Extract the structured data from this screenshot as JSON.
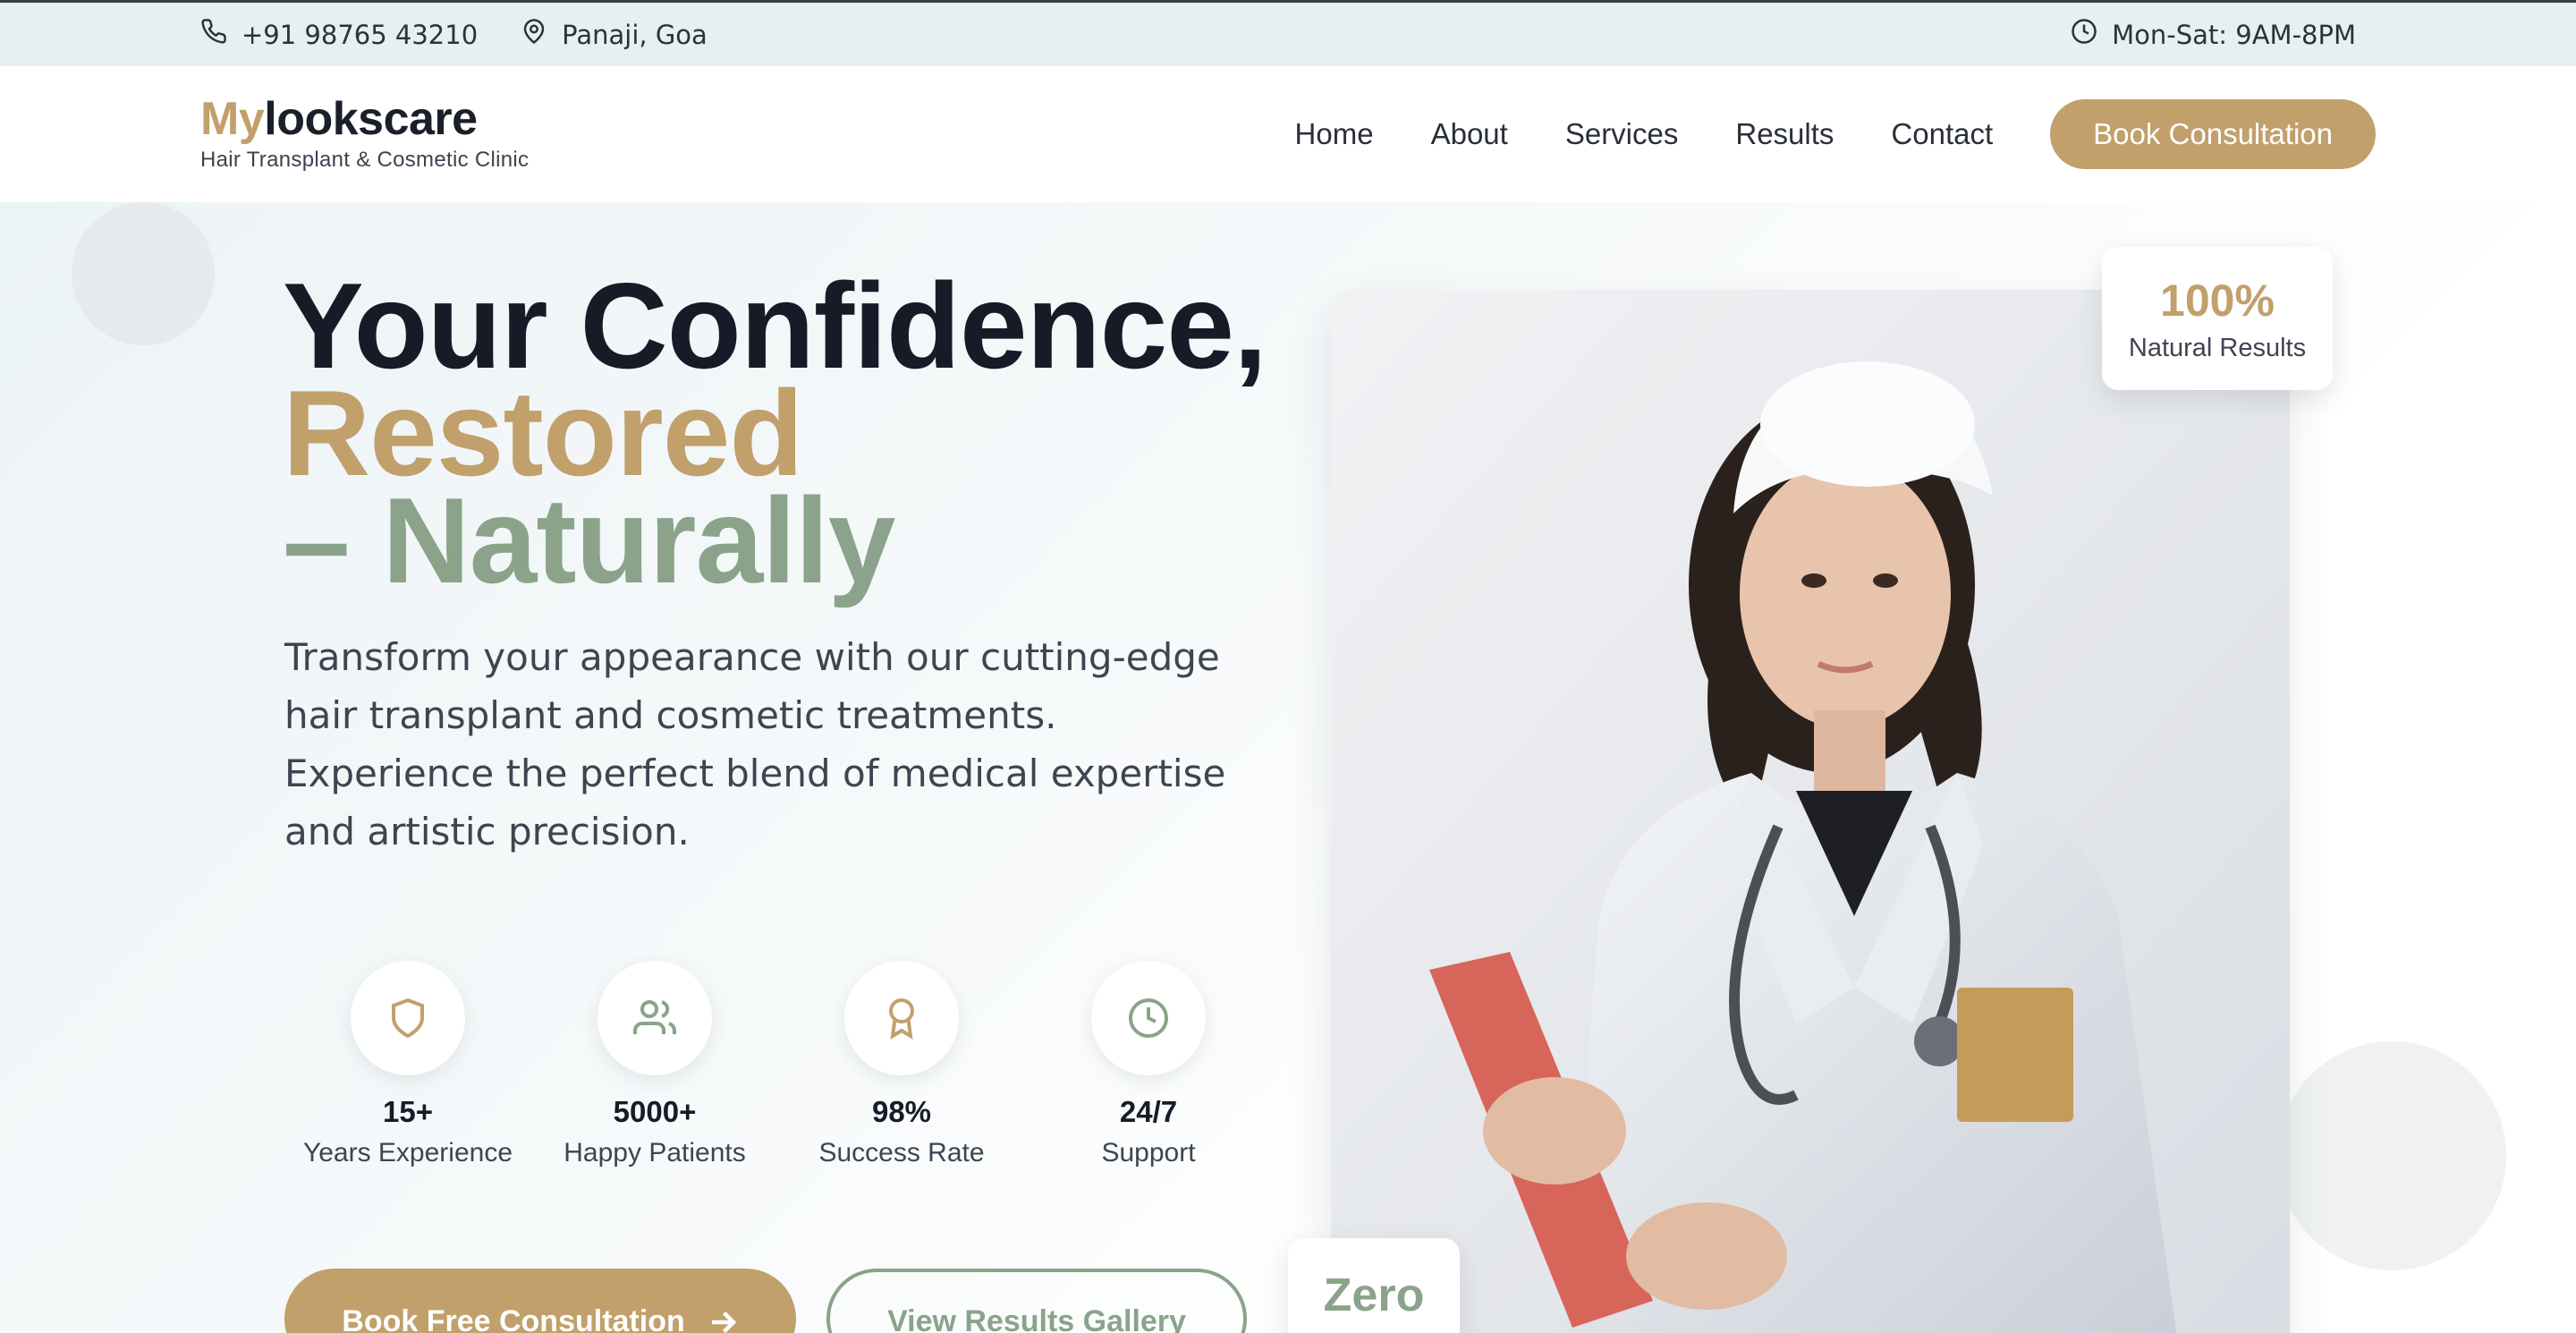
{
  "topbar": {
    "phone": "+91 98765 43210",
    "location": "Panaji, Goa",
    "hours": "Mon-Sat: 9AM-8PM",
    "icons": [
      "phone-icon",
      "map-pin-icon",
      "clock-icon"
    ]
  },
  "header": {
    "logo_prefix": "My",
    "logo_rest": "lookscare",
    "tagline": "Hair Transplant & Cosmetic Clinic",
    "nav": [
      {
        "label": "Home"
      },
      {
        "label": "About"
      },
      {
        "label": "Services"
      },
      {
        "label": "Results"
      },
      {
        "label": "Contact"
      }
    ],
    "cta_label": "Book Consultation"
  },
  "hero": {
    "headline_line1": "Your Confidence,",
    "headline_line2": "Restored",
    "headline_line3": "– Naturally",
    "intro": "Transform your appearance with our cutting-edge hair transplant and cosmetic treatments. Experience the perfect blend of medical expertise and artistic precision.",
    "stats": [
      {
        "value": "15+",
        "label": "Years Experience",
        "icon": "shield-icon"
      },
      {
        "value": "5000+",
        "label": "Happy Patients",
        "icon": "users-icon"
      },
      {
        "value": "98%",
        "label": "Success Rate",
        "icon": "award-icon"
      },
      {
        "value": "24/7",
        "label": "Support",
        "icon": "clock-icon"
      }
    ],
    "primary_cta": "Book Free Consultation",
    "secondary_cta": "View Results Gallery",
    "badge_top_value": "100%",
    "badge_top_label": "Natural Results",
    "badge_bottom_value": "Zero"
  },
  "colors": {
    "accent_gold": "#c1a06c",
    "accent_sage": "#8aa38a",
    "heading_dark": "#161b27",
    "topbar_bg": "#e6f0f1"
  }
}
